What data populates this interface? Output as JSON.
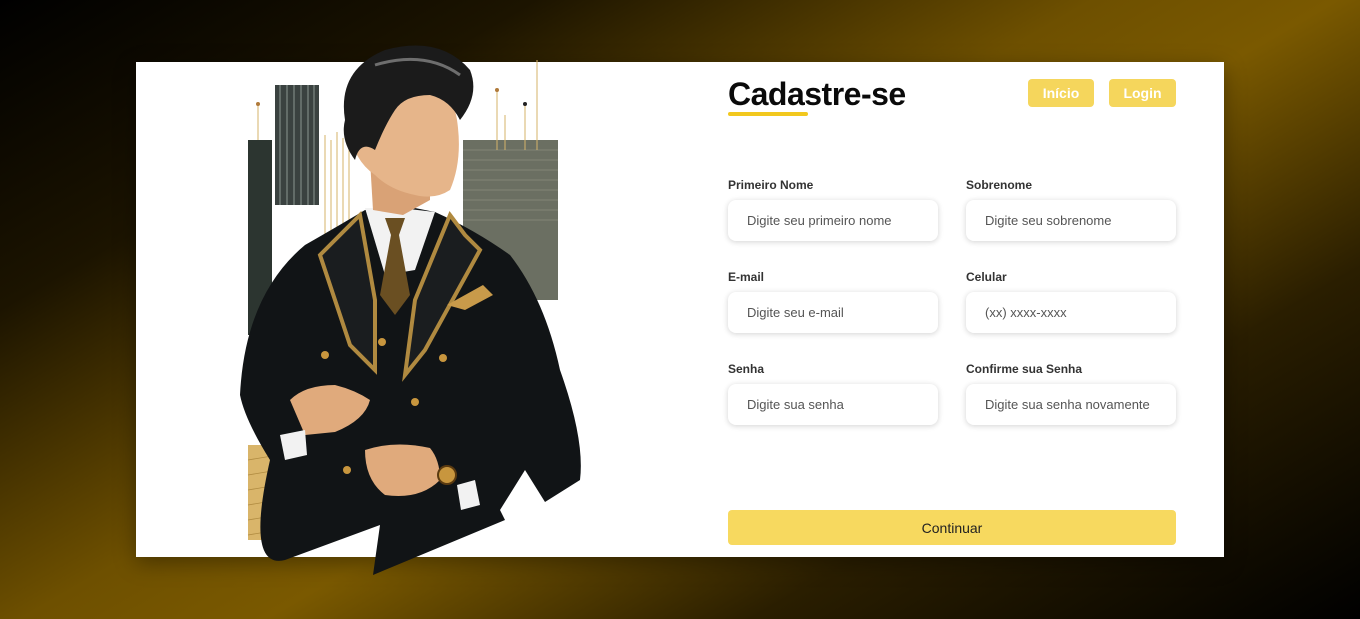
{
  "header": {
    "title": "Cadastre-se",
    "nav": {
      "home_label": "Início",
      "login_label": "Login"
    }
  },
  "form": {
    "first_name": {
      "label": "Primeiro Nome",
      "placeholder": "Digite seu primeiro nome"
    },
    "last_name": {
      "label": "Sobrenome",
      "placeholder": "Digite seu sobrenome"
    },
    "email": {
      "label": "E-mail",
      "placeholder": "Digite seu e-mail"
    },
    "phone": {
      "label": "Celular",
      "placeholder": "(xx) xxxx-xxxx"
    },
    "password": {
      "label": "Senha",
      "placeholder": "Digite sua senha"
    },
    "confirm_password": {
      "label": "Confirme sua Senha",
      "placeholder": "Digite sua senha novamente"
    },
    "submit_label": "Continuar"
  },
  "colors": {
    "accent": "#f5d65c",
    "underline": "#f2c81e"
  }
}
